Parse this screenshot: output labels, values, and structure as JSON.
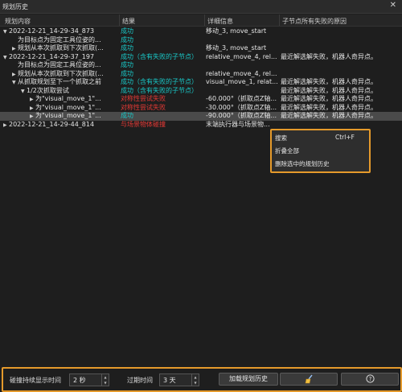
{
  "window": {
    "title": "规划历史",
    "close_icon": "close-icon"
  },
  "columns": [
    "规划内容",
    "结果",
    "详细信息",
    "子节点所有失败的原因"
  ],
  "rows": [
    {
      "arrow": "▼",
      "indent": 0,
      "content": "2022-12-21_14-29-34_873",
      "result": "成功",
      "result_status": "ok",
      "detail": "移动_3, move_start",
      "reason": "",
      "selected": false
    },
    {
      "arrow": "",
      "indent": 1,
      "content": "为目标点为固定工具位姿的...",
      "result": "成功",
      "result_status": "ok",
      "detail": "",
      "reason": "",
      "selected": false
    },
    {
      "arrow": "▶",
      "indent": 1,
      "content": "规划从本次抓取到下次抓取(...",
      "result": "成功",
      "result_status": "ok",
      "detail": "移动_3, move_start",
      "reason": "",
      "selected": false
    },
    {
      "arrow": "▼",
      "indent": 0,
      "content": "2022-12-21_14-29-37_197",
      "result": "成功（含有失败的子节点）",
      "result_status": "ok",
      "detail": "relative_move_4, rel...",
      "reason": "最近解选解失败，机器人奇异点。",
      "selected": false
    },
    {
      "arrow": "",
      "indent": 1,
      "content": "为目标点为固定工具位姿的...",
      "result": "成功",
      "result_status": "ok",
      "detail": "",
      "reason": "",
      "selected": false
    },
    {
      "arrow": "▶",
      "indent": 1,
      "content": "规划从本次抓取到下次抓取(...",
      "result": "成功",
      "result_status": "ok",
      "detail": "relative_move_4, rel...",
      "reason": "",
      "selected": false
    },
    {
      "arrow": "▼",
      "indent": 1,
      "content": "从抓取规划至下一个抓取之前",
      "result": "成功（含有失败的子节点）",
      "result_status": "ok",
      "detail": "visual_move_1, relat...",
      "reason": "最近解选解失败，机器人奇异点。",
      "selected": false
    },
    {
      "arrow": "▼",
      "indent": 2,
      "content": "1/2次抓取尝试",
      "result": "成功（含有失败的子节点）",
      "result_status": "ok",
      "detail": "",
      "reason": "最近解选解失败，机器人奇异点。",
      "selected": false
    },
    {
      "arrow": "▶",
      "indent": 3,
      "content": "为\"visual_move_1\"...",
      "result": "对称性尝试失败",
      "result_status": "bad",
      "detail": "-60.000°（抓取点Z轴...",
      "reason": "最近解选解失败，机器人奇异点。",
      "selected": false
    },
    {
      "arrow": "▶",
      "indent": 3,
      "content": "为\"visual_move_1\"...",
      "result": "对称性尝试失败",
      "result_status": "bad",
      "detail": "-30.000°（抓取点Z轴...",
      "reason": "最近解选解失败，机器人奇异点。",
      "selected": false
    },
    {
      "arrow": "▶",
      "indent": 3,
      "content": "为\"visual_move_1\"...",
      "result": "成功",
      "result_status": "ok",
      "detail": "-90.000°（抓取点Z轴...",
      "reason": "最近解选解失败，机器人奇异点。",
      "selected": true
    },
    {
      "arrow": "▶",
      "indent": 0,
      "content": "2022-12-21_14-29-44_814",
      "result": "与场景物体碰撞",
      "result_status": "bad",
      "detail": "末端执行器与场景物...",
      "reason": "",
      "selected": false
    }
  ],
  "context_menu": {
    "search": "搜索",
    "search_shortcut": "Ctrl+F",
    "collapse_all": "折叠全部",
    "delete_selected": "删除选中的规划历史"
  },
  "footer": {
    "collision_label": "碰撞持续显示时间",
    "collision_value": "2 秒",
    "expire_label": "过期时间",
    "expire_value": "3 天",
    "load_button": "加载规划历史",
    "clean_icon": "broom-icon",
    "help_icon": "help-icon"
  },
  "colors": {
    "accent": "#e59a2b",
    "success": "#19c8c8",
    "failure": "#e53935"
  }
}
